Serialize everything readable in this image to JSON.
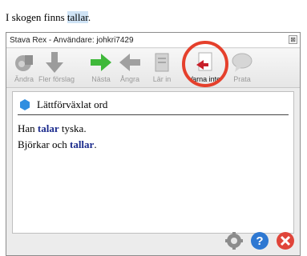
{
  "document": {
    "prefix": "I skogen finns ",
    "highlight": "tallar",
    "suffix": "."
  },
  "window": {
    "title": "Stava Rex - Användare: johkri7429",
    "close_glyph": "⊠"
  },
  "toolbar": {
    "buttons": [
      {
        "label": "Ändra",
        "icon": "change-icon",
        "active": false
      },
      {
        "label": "Fler förslag",
        "icon": "down-arrow-icon",
        "active": false
      },
      {
        "label": "Nästa",
        "icon": "next-arrow-icon",
        "active": true
      },
      {
        "label": "Ångra",
        "icon": "undo-arrow-icon",
        "active": false
      },
      {
        "label": "Lär in",
        "icon": "learn-icon",
        "active": false
      },
      {
        "label": "Varna inte",
        "icon": "no-warn-icon",
        "active": true
      },
      {
        "label": "Prata",
        "icon": "speech-icon",
        "active": false
      }
    ]
  },
  "panel": {
    "category": "Lättförväxlat ord",
    "sentences": [
      {
        "before": "Han ",
        "word": "talar",
        "after": " tyska."
      },
      {
        "before": "Björkar och ",
        "word": "tallar",
        "after": "."
      }
    ]
  },
  "footer": {
    "icons": [
      "settings-icon",
      "help-icon",
      "close-icon"
    ]
  },
  "colors": {
    "highlight_ring": "#e5402c",
    "word_blue": "#1a2a8c"
  }
}
